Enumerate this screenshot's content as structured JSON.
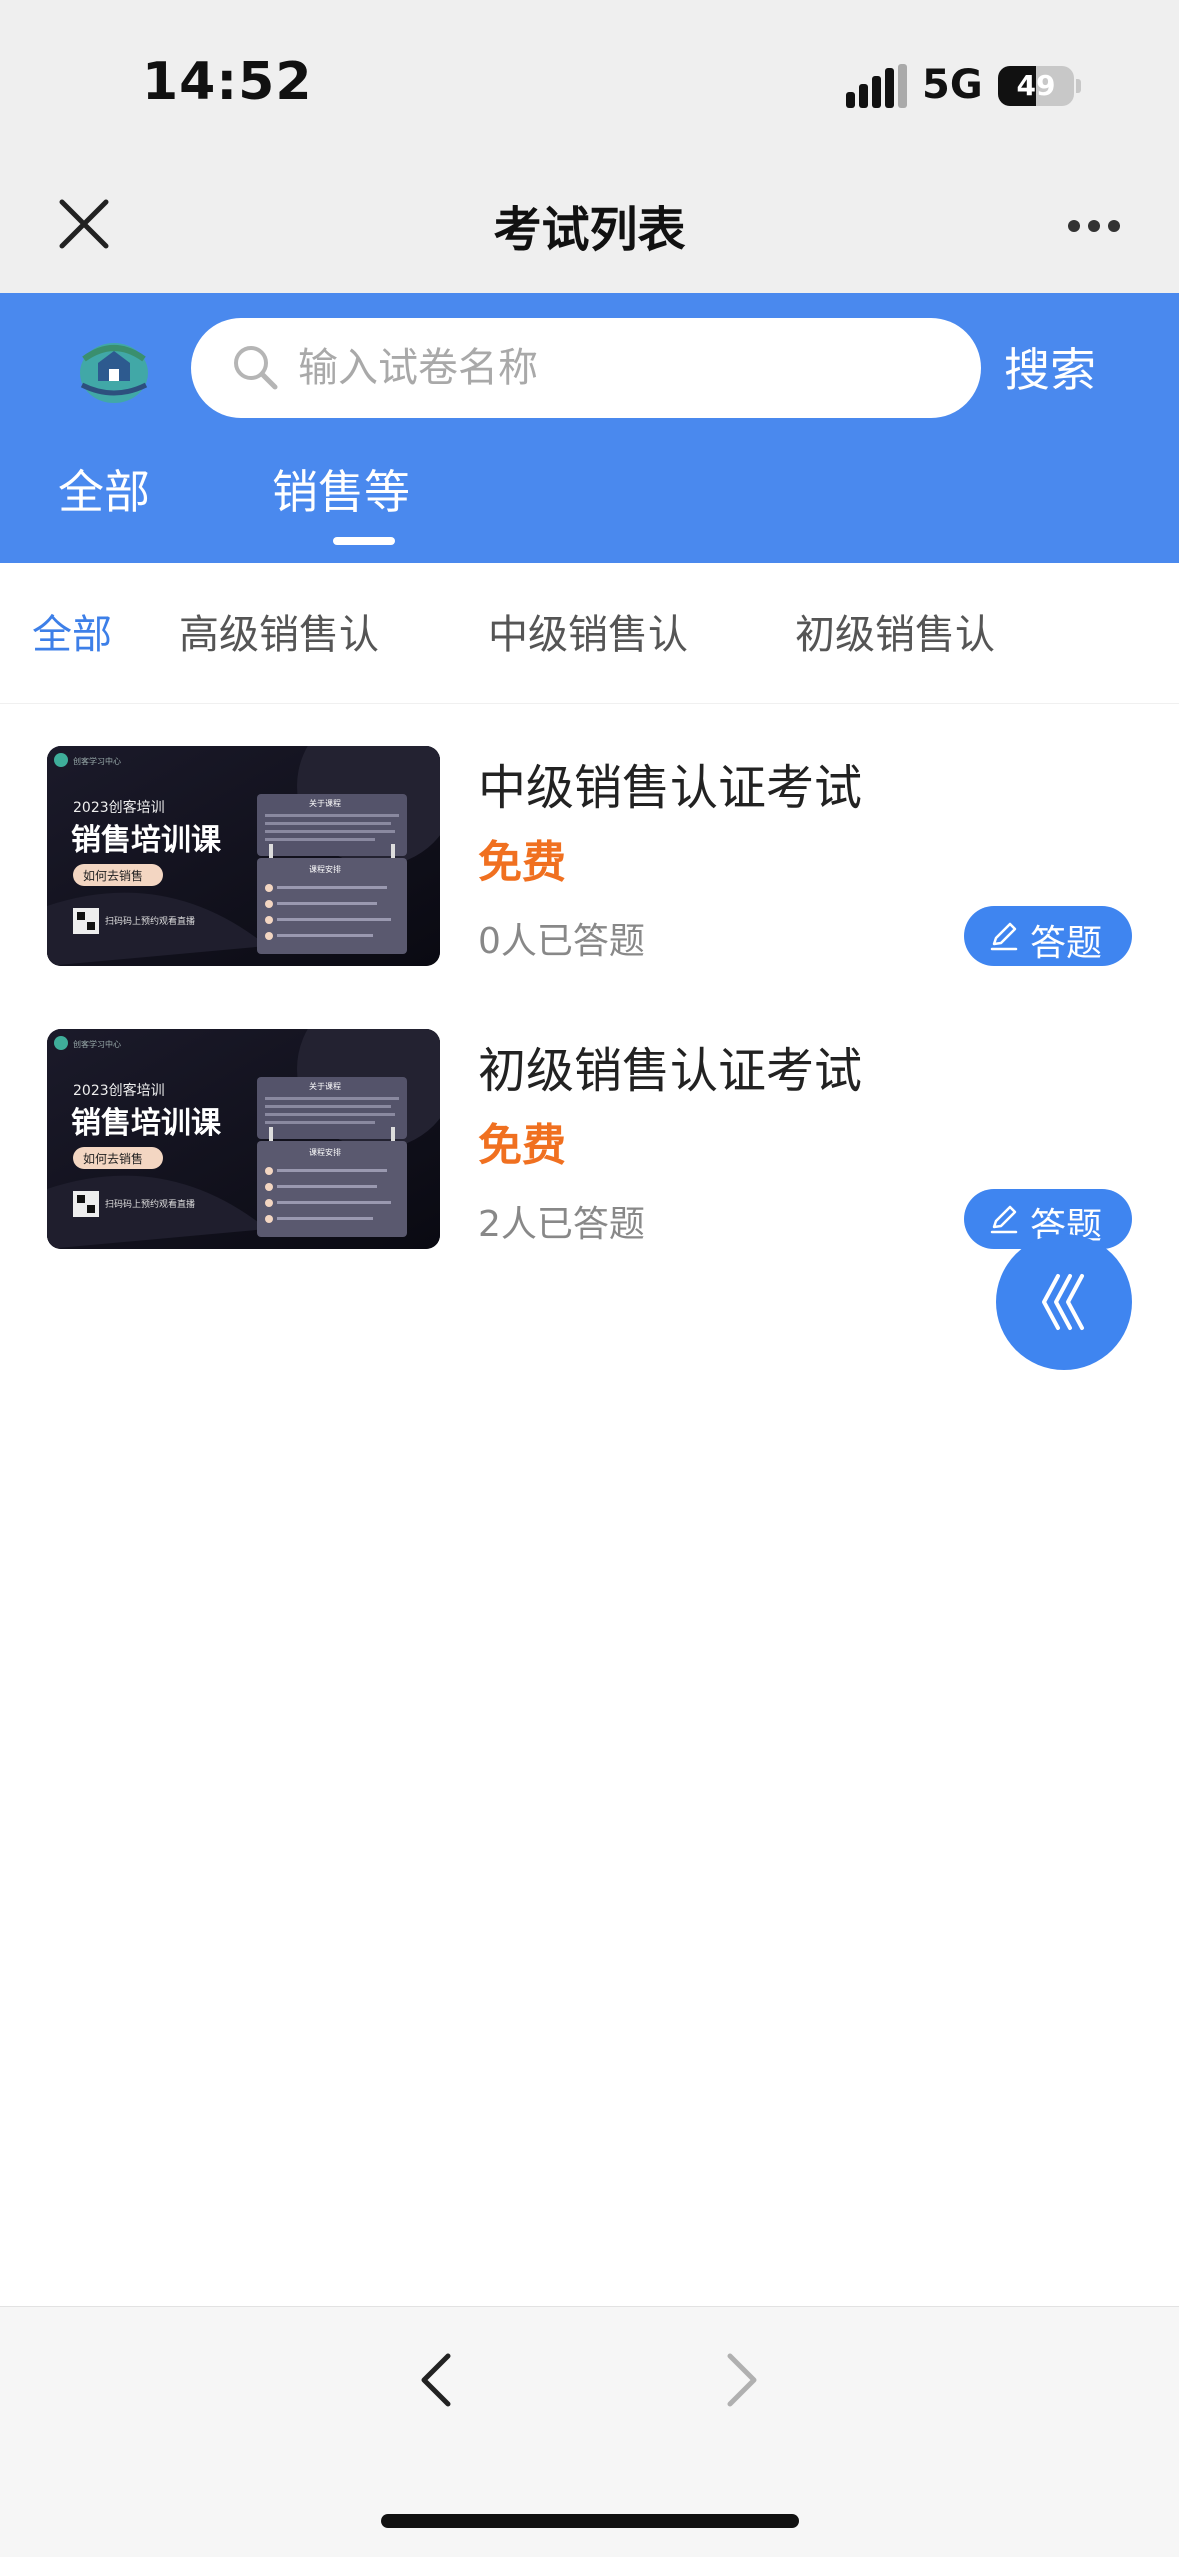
{
  "status_bar": {
    "time": "14:52",
    "network": "5G",
    "battery_level": "49"
  },
  "nav": {
    "title": "考试列表"
  },
  "search": {
    "placeholder": "输入试卷名称",
    "button_label": "搜索"
  },
  "tabs": [
    {
      "label": "全部",
      "active": false
    },
    {
      "label": "销售等",
      "active": true
    }
  ],
  "filters": [
    {
      "label": "全部",
      "active": true
    },
    {
      "label": "高级销售认",
      "active": false
    },
    {
      "label": "中级销售认",
      "active": false
    },
    {
      "label": "初级销售认",
      "active": false
    }
  ],
  "thumbnail": {
    "logo_text": "创客学习中心",
    "year_label": "2023创客培训",
    "headline": "销售培训课",
    "tag": "如何去销售",
    "qr_caption": "扫码码上预约观看直播",
    "panel_title_1": "关于课程",
    "panel_title_2": "课程安排"
  },
  "exams": [
    {
      "title": "中级销售认证考试",
      "price": "免费",
      "count": "0人已答题",
      "button_label": "答题"
    },
    {
      "title": "初级销售认证考试",
      "price": "免费",
      "count": "2人已答题",
      "button_label": "答题"
    }
  ],
  "colors": {
    "primary": "#4a89ee",
    "accent_price": "#f07020",
    "button_blue": "#3f85f0"
  }
}
